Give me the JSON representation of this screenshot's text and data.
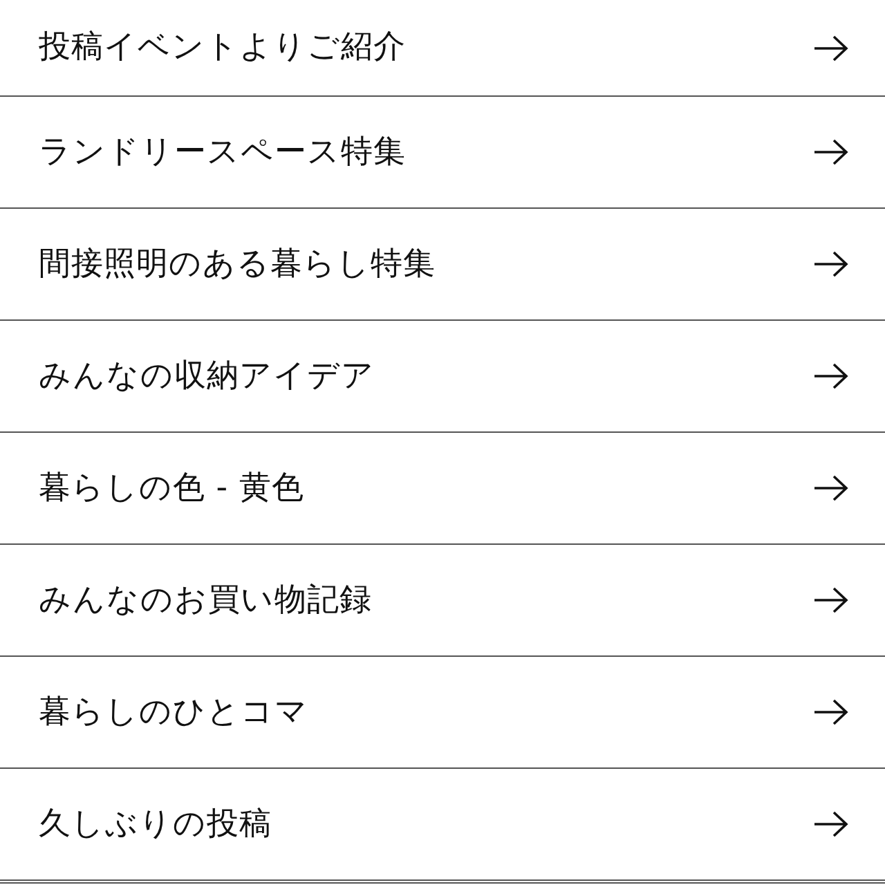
{
  "items": [
    {
      "label": "投稿イベントよりご紹介"
    },
    {
      "label": "ランドリースペース特集"
    },
    {
      "label": "間接照明のある暮らし特集"
    },
    {
      "label": "みんなの収納アイデア"
    },
    {
      "label": "暮らしの色 - 黄色"
    },
    {
      "label": "みんなのお買い物記録"
    },
    {
      "label": "暮らしのひとコマ"
    },
    {
      "label": "久しぶりの投稿"
    }
  ]
}
